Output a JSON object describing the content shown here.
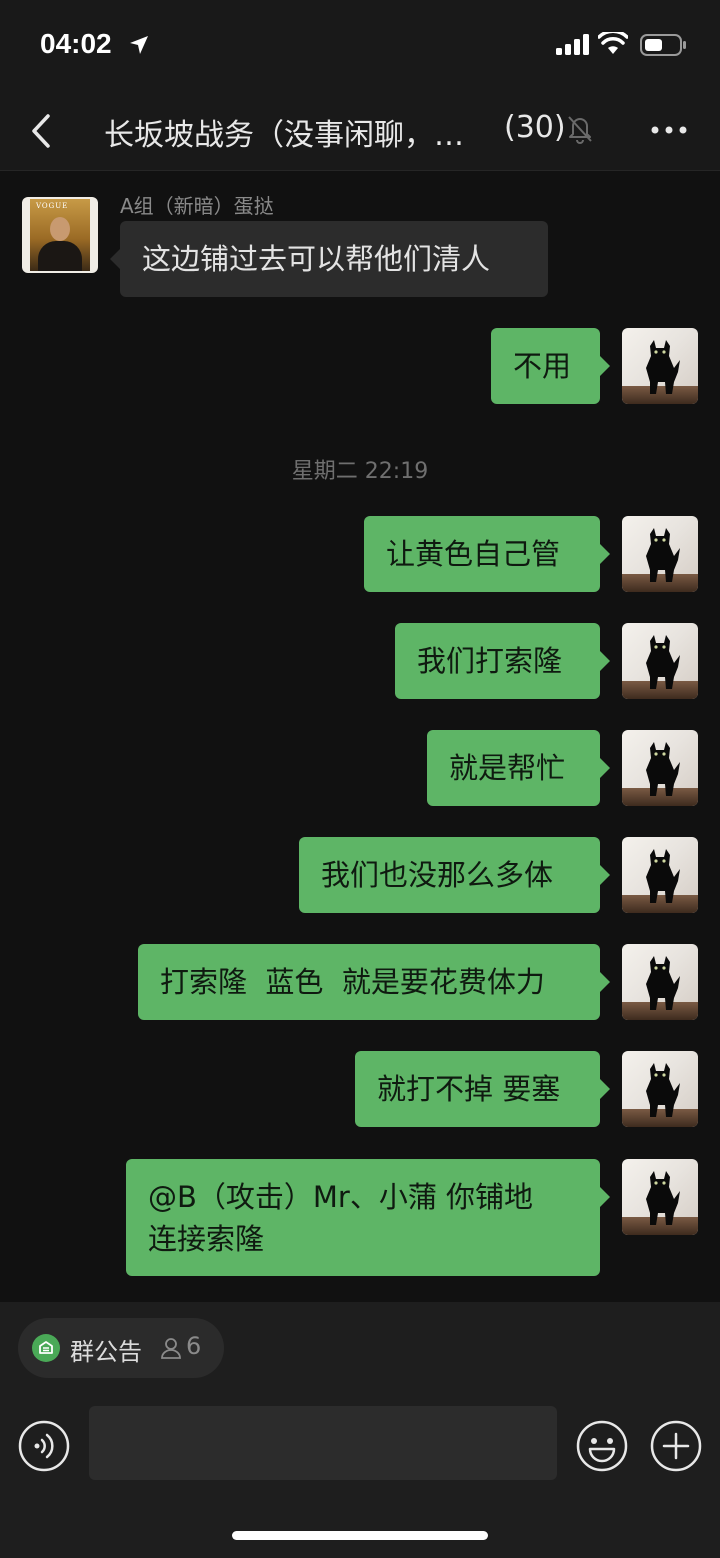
{
  "status_bar": {
    "time": "04:02"
  },
  "header": {
    "title": "长坂坡战务（没事闲聊，…",
    "member_count": "(30)",
    "icons": [
      "back-icon",
      "mute-bell-icon",
      "more-icon"
    ]
  },
  "messages": [
    {
      "direction": "in",
      "sender": "A组（新暗）蛋挞",
      "text": "这边铺过去可以帮他们清人"
    },
    {
      "direction": "out",
      "text": "不用"
    },
    {
      "type": "timestamp",
      "text": "星期二 22:19"
    },
    {
      "direction": "out",
      "text": "让黄色自己管"
    },
    {
      "direction": "out",
      "text": "我们打索隆"
    },
    {
      "direction": "out",
      "text": "就是帮忙"
    },
    {
      "direction": "out",
      "text": "我们也没那么多体"
    },
    {
      "direction": "out",
      "text": "打索隆  蓝色  就是要花费体力"
    },
    {
      "direction": "out",
      "text": "就打不掉 要塞"
    },
    {
      "direction": "out",
      "line1": "@B（攻击）Mr、小蒲 你铺地",
      "line2": "连接索隆"
    }
  ],
  "bottom": {
    "announcement_label": "群公告",
    "announcement_count": "6",
    "input_value": "",
    "icons": [
      "voice-icon",
      "emoji-icon",
      "plus-icon"
    ]
  },
  "colors": {
    "background": "#111111",
    "outgoing_bubble": "#5eb566",
    "incoming_bubble": "#2c2c2c"
  }
}
